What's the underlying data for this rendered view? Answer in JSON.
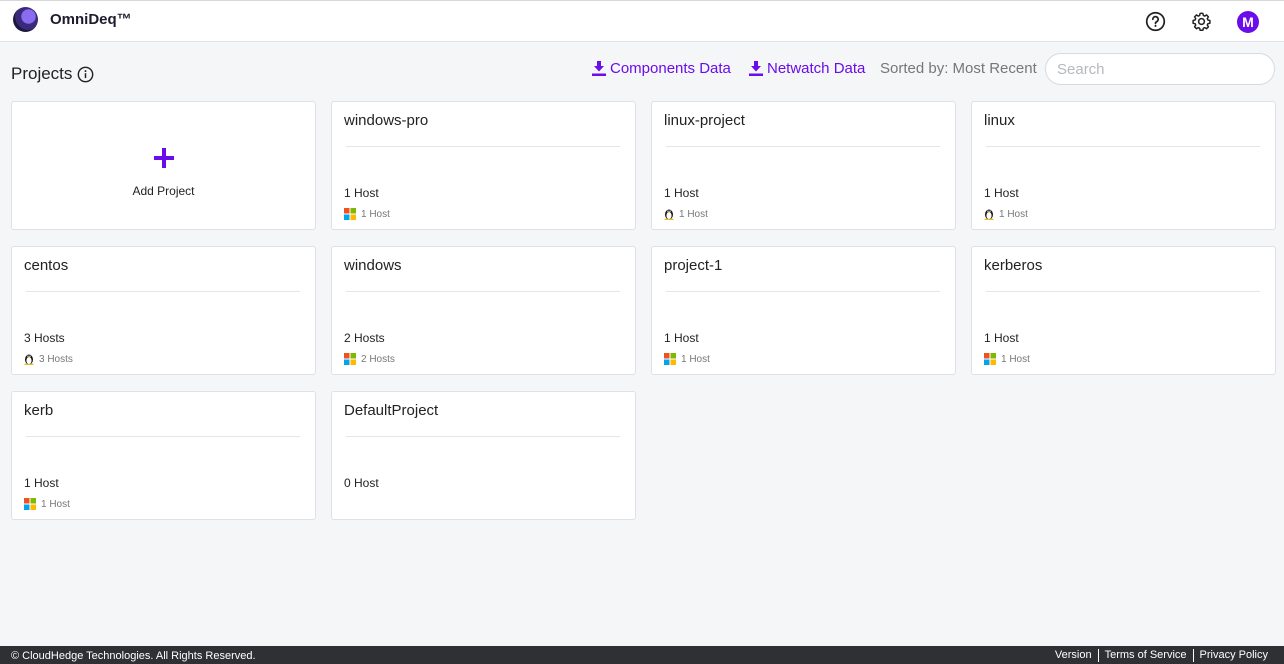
{
  "app": {
    "brand": "OmniDeq™"
  },
  "header": {
    "page_title": "Projects",
    "components_label": "Components Data",
    "netwatch_label": "Netwatch Data",
    "sorted_label": "Sorted by: Most Recent",
    "search_placeholder": "Search",
    "avatar_initial": "M"
  },
  "add_card": {
    "label": "Add Project"
  },
  "projects": [
    {
      "name": "windows-pro",
      "count": "1 Host",
      "os": "windows",
      "os_count": "1 Host"
    },
    {
      "name": "linux-project",
      "count": "1 Host",
      "os": "linux",
      "os_count": "1 Host"
    },
    {
      "name": "linux",
      "count": "1 Host",
      "os": "linux",
      "os_count": "1 Host"
    },
    {
      "name": "centos",
      "count": "3 Hosts",
      "os": "linux",
      "os_count": "3 Hosts"
    },
    {
      "name": "windows",
      "count": "2 Hosts",
      "os": "windows",
      "os_count": "2 Hosts"
    },
    {
      "name": "project-1",
      "count": "1 Host",
      "os": "windows",
      "os_count": "1 Host"
    },
    {
      "name": "kerberos",
      "count": "1 Host",
      "os": "windows",
      "os_count": "1 Host"
    },
    {
      "name": "kerb",
      "count": "1 Host",
      "os": "windows",
      "os_count": "1 Host"
    },
    {
      "name": "DefaultProject",
      "count": "0 Host",
      "os": "",
      "os_count": ""
    }
  ],
  "footer": {
    "copyright": "© CloudHedge Technologies. All Rights Reserved.",
    "version": "Version",
    "terms": "Terms of Service",
    "privacy": "Privacy Policy"
  },
  "colors": {
    "accent": "#6a0dea",
    "footer_bg": "#2f3033"
  },
  "icons": {
    "help": "help-circle-icon",
    "settings": "gear-icon",
    "info": "info-icon",
    "download": "download-icon",
    "plus": "plus-icon",
    "windows": "windows-icon",
    "linux": "linux-tux-icon"
  }
}
